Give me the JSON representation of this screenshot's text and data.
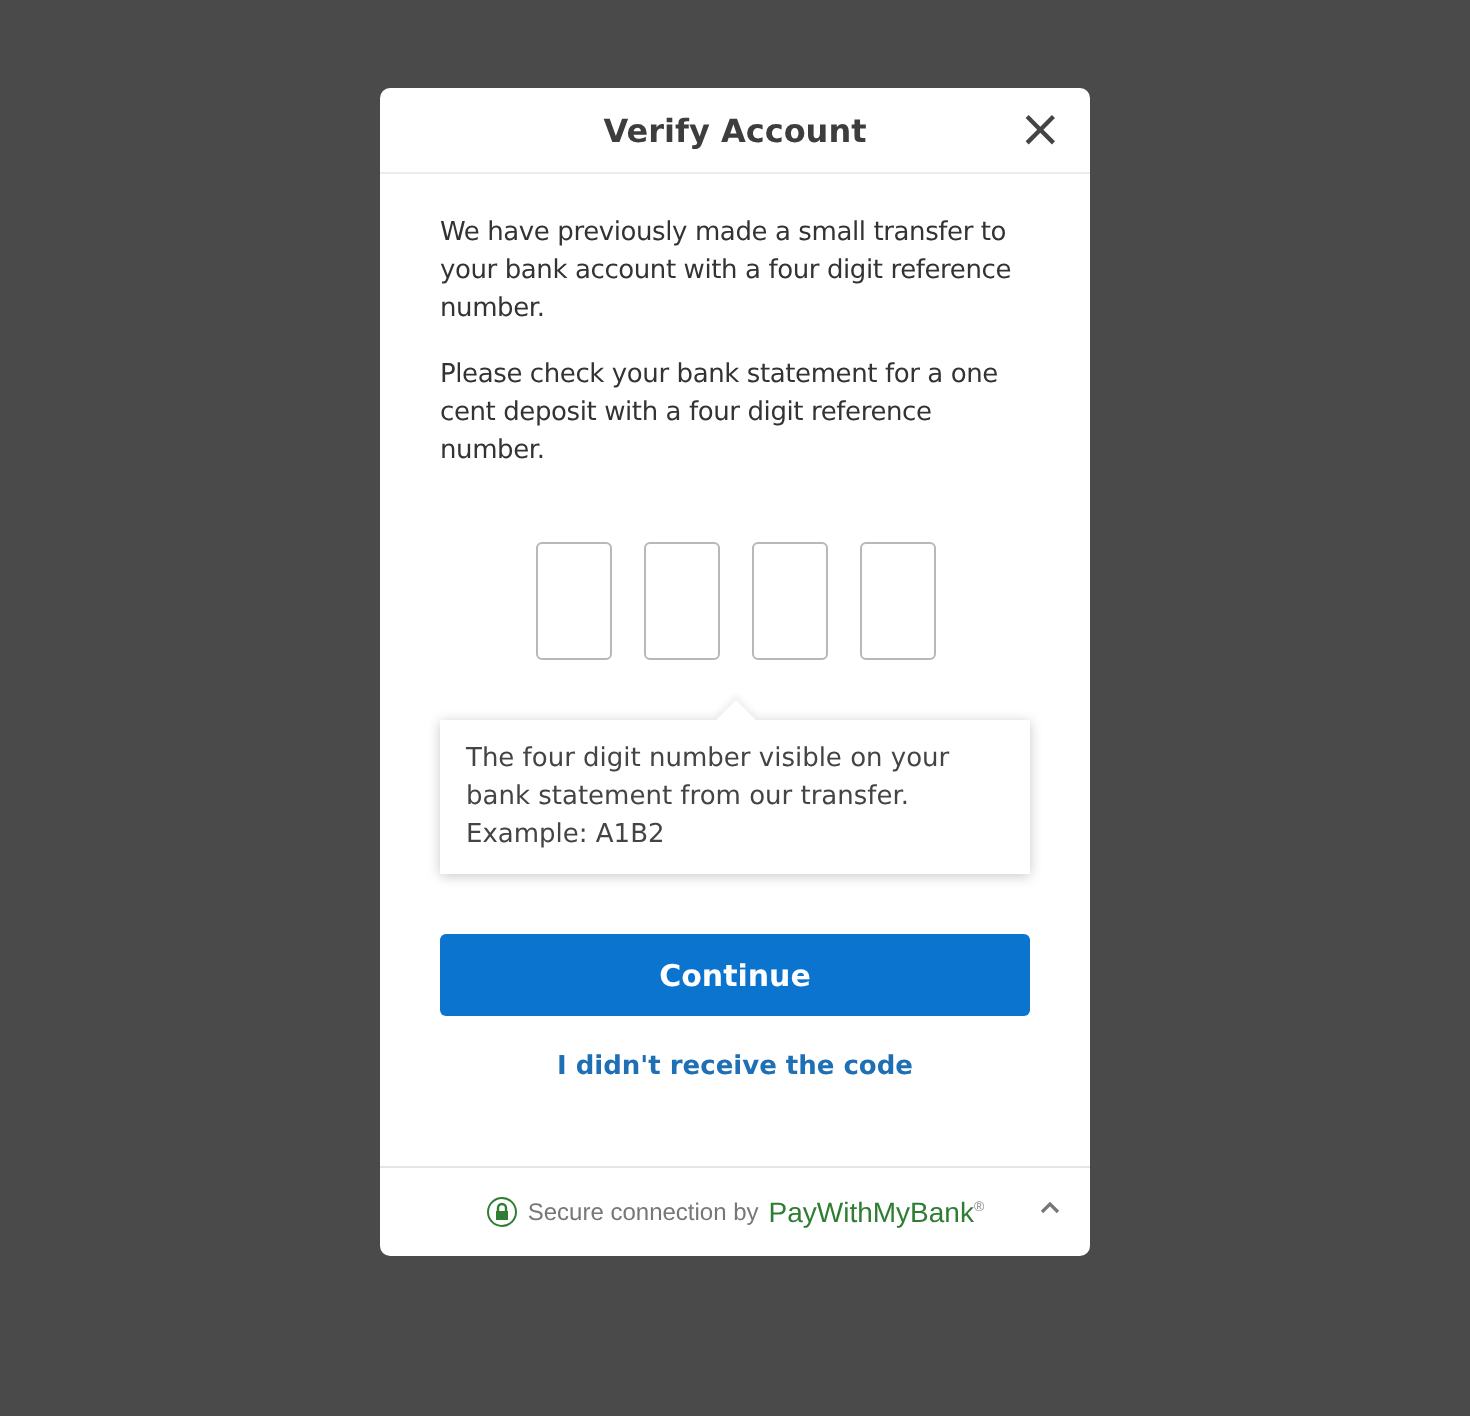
{
  "dialog": {
    "title": "Verify Account",
    "close_icon": "×"
  },
  "paragraphs": [
    "We have previously made a small transfer to your bank account with a four digit reference number.",
    "Please check your bank statement for a one cent deposit with a four digit reference number."
  ],
  "code_fields": [
    {
      "kind": "digit"
    },
    {
      "kind": "digit"
    },
    {
      "kind": "digit"
    },
    {
      "kind": "digit"
    }
  ],
  "tooltip": {
    "text": "The four digit number visible on your bank statement from our transfer. Example: A1B2"
  },
  "continue_button": "Continue",
  "resend_link": "I didn't receive the code",
  "footer": {
    "label": "Secure connection by",
    "brand": "PayWithMyBank$^{®}$",
    "expanded": false
  }
}
